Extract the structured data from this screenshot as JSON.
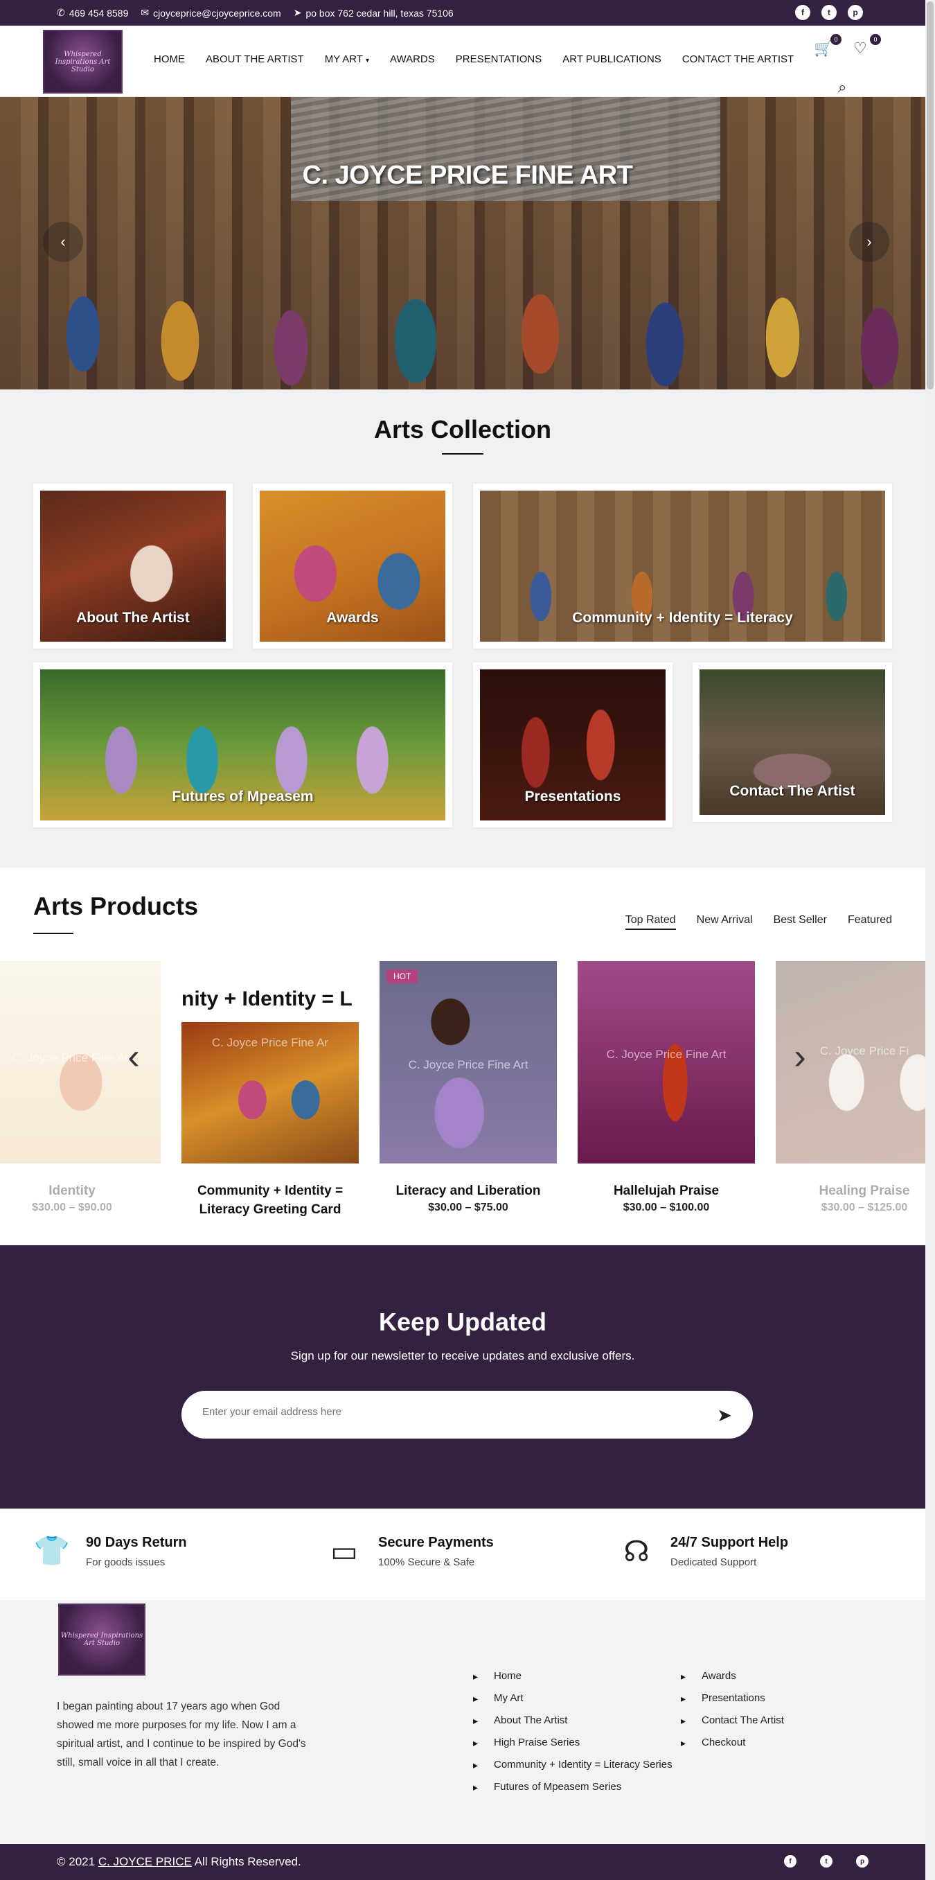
{
  "topbar": {
    "phone": "469 454 8589",
    "email": "cjoyceprice@cjoyceprice.com",
    "address": "po box 762 cedar hill, texas 75106",
    "phone_icon": "phone-icon",
    "email_icon": "envelope-icon",
    "address_icon": "location-arrow-icon"
  },
  "header": {
    "logo_text": "Whispered Inspirations Art Studio",
    "nav": [
      "HOME",
      "ABOUT THE ARTIST",
      "MY ART",
      "AWARDS",
      "PRESENTATIONS",
      "ART PUBLICATIONS",
      "CONTACT THE ARTIST"
    ],
    "cart_count": "0",
    "wishlist_count": "0"
  },
  "hero": {
    "title": "C. JOYCE PRICE FINE ART"
  },
  "collection": {
    "title": "Arts Collection",
    "cards": [
      "About The Artist",
      "Awards",
      "Community + Identity = Literacy",
      "Futures of Mpeasem",
      "Presentations",
      "Contact The Artist"
    ]
  },
  "products": {
    "title": "Arts Products",
    "tabs": [
      "Top Rated",
      "New Arrival",
      "Best Seller",
      "Featured"
    ],
    "items": [
      {
        "name": "Identity",
        "price": "$30.00 – $90.00"
      },
      {
        "name": "Community + Identity = Literacy Greeting Card",
        "price": "",
        "banner": "nity + Identity = L",
        "watermark": "C. Joyce Price Fine Ar"
      },
      {
        "name": "Literacy and Liberation",
        "price": "$30.00 – $75.00",
        "badge": "HOT",
        "watermark": "C. Joyce Price Fine Art"
      },
      {
        "name": "Hallelujah Praise",
        "price": "$30.00 – $100.00",
        "watermark": "C. Joyce Price Fine Art"
      },
      {
        "name": "Healing Praise",
        "price": "$30.00 – $125.00",
        "watermark": "C. Joyce Price Fi"
      }
    ],
    "watermark_first": "C. Joyce Price Fine Art"
  },
  "newsletter": {
    "title": "Keep Updated",
    "subtitle": "Sign up for our newsletter to receive updates and exclusive offers.",
    "placeholder": "Enter your email address here"
  },
  "features": [
    {
      "title": "90 Days Return",
      "sub": "For goods issues",
      "icon": "tshirt-icon"
    },
    {
      "title": "Secure Payments",
      "sub": "100% Secure & Safe",
      "icon": "wallet-icon"
    },
    {
      "title": "24/7 Support Help",
      "sub": "Dedicated Support",
      "icon": "headset-icon"
    }
  ],
  "footer": {
    "about": "I began painting about 17 years ago when God showed me more purposes for my life. Now I am a spiritual artist, and I continue to be inspired by God's still, small voice in all that I create.",
    "links_col1": [
      "Home",
      "My Art",
      "About The Artist",
      "High Praise Series",
      "Community + Identity = Literacy Series",
      "Futures of Mpeasem Series"
    ],
    "links_col2": [
      "Awards",
      "Presentations",
      "Contact The Artist",
      "Checkout"
    ]
  },
  "bottombar": {
    "copy_prefix": "© 2021",
    "copy_link": "C. JOYCE PRICE",
    "copy_suffix": "All Rights Reserved."
  },
  "colors": {
    "brand": "#34213f",
    "hot_badge": "#b4427c"
  }
}
